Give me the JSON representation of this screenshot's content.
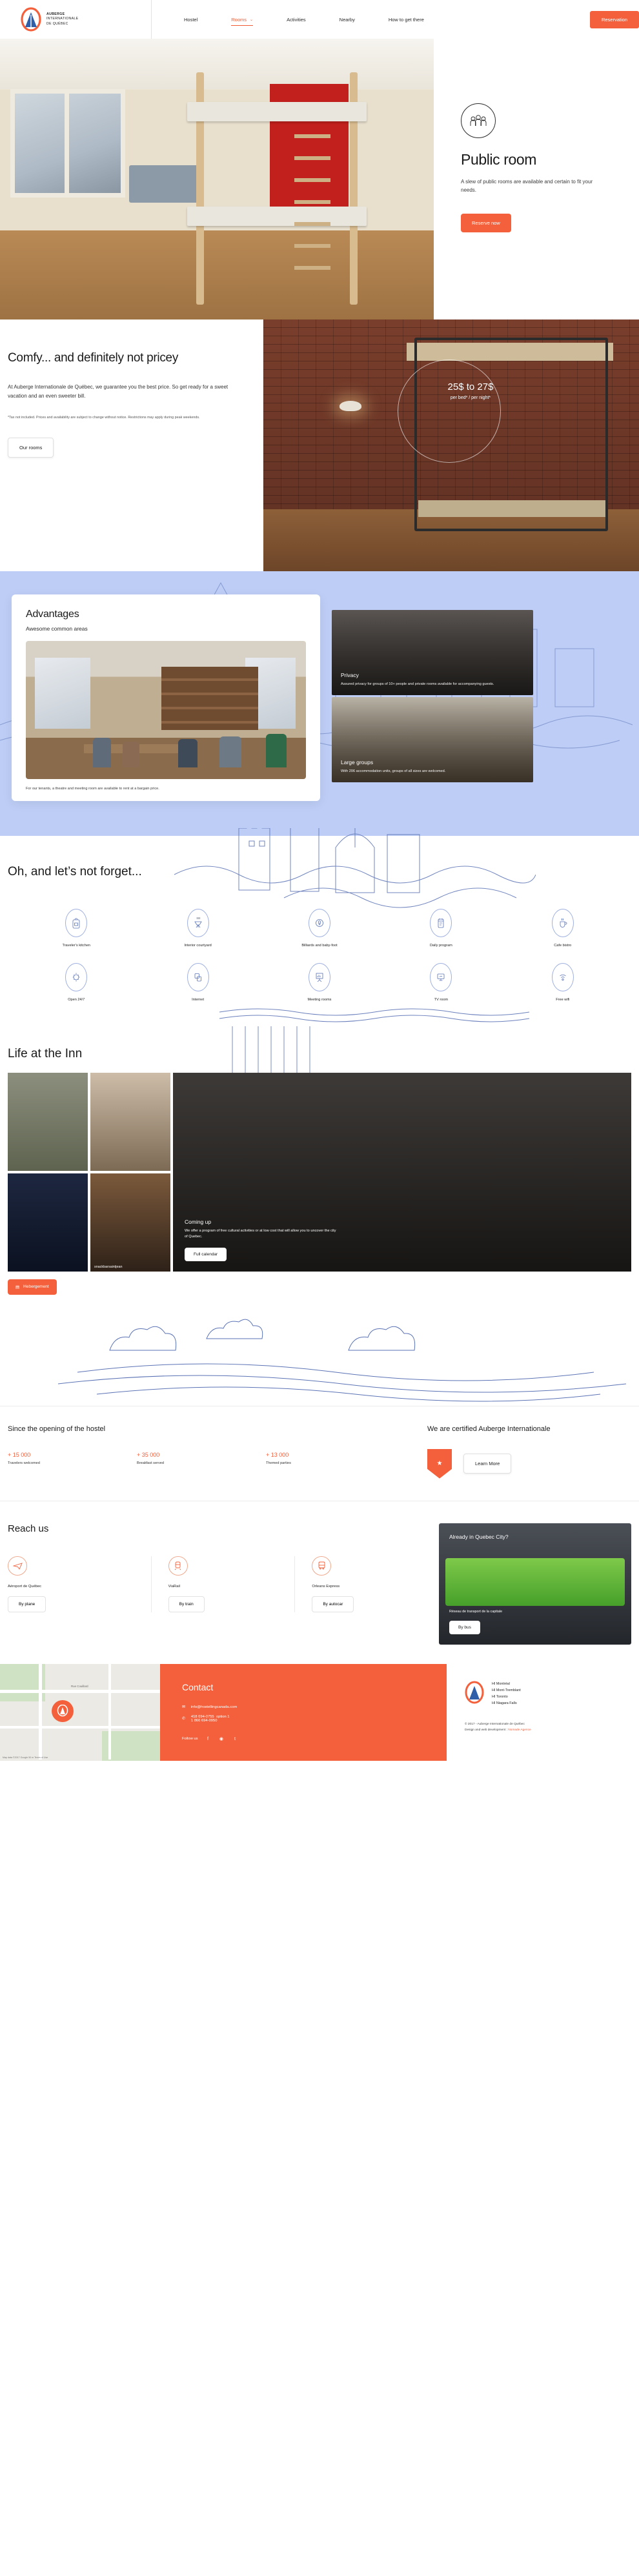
{
  "header": {
    "logo": {
      "line1": "AUBERGE",
      "line2": "INTERNATIONALE",
      "line3": "DE QUÉBEC"
    },
    "nav": [
      {
        "label": "Hostel",
        "active": false
      },
      {
        "label": "Rooms",
        "active": true,
        "chevron": "chevron-down-icon"
      },
      {
        "label": "Activities",
        "active": false
      },
      {
        "label": "Nearby",
        "active": false
      },
      {
        "label": "How to get there",
        "active": false
      }
    ],
    "reservation_button": "Reservation"
  },
  "hero": {
    "icon": "group-people-icon",
    "title": "Public room",
    "description": "A slew of public rooms are available and certain to fit your needs.",
    "cta": "Reserve now"
  },
  "pricing": {
    "title": "Comfy... and definitely not pricey",
    "lead": "At Auberge Internationale de Québec, we guarantee you the best price. So get ready for a sweet vacation and an even sweeter bill.",
    "fine_print": "*Tax not included. Prices and availability are subject to change without notice. Restrictions may apply during peak weekends.",
    "cta": "Our rooms",
    "price_main": "25$ to 27$",
    "price_sub": "per bed* / per night*"
  },
  "advantages": {
    "title": "Advantages",
    "subtitle": "Awesome common areas",
    "footnote": "For our tenants, a theatre and meeting room are available to rent at a bargain price.",
    "tiles": [
      {
        "title": "Privacy",
        "desc": "Assured privacy for groups of 10+ people and private rooms available for accompanying guests."
      },
      {
        "title": "Large groups",
        "desc": "With 206 accommodation units, groups of all sizes are welcomed."
      }
    ]
  },
  "amenities": {
    "title": "Oh, and let’s not forget...",
    "items": [
      {
        "label": "Traveler's kitchen",
        "icon": "backpack-icon"
      },
      {
        "label": "Interior courtyard",
        "icon": "grill-icon"
      },
      {
        "label": "Billiards and baby-foot",
        "icon": "billiard-ball-icon"
      },
      {
        "label": "Daily program",
        "icon": "calendar-phone-icon"
      },
      {
        "label": "Cafe bistro",
        "icon": "coffee-cup-icon"
      },
      {
        "label": "Open 24/7",
        "icon": "sun-icon"
      },
      {
        "label": "Internet",
        "icon": "computer-icon"
      },
      {
        "label": "Meeting rooms",
        "icon": "presentation-board-icon"
      },
      {
        "label": "TV room",
        "icon": "tv-screen-icon"
      },
      {
        "label": "Free wifi",
        "icon": "wifi-icon"
      }
    ]
  },
  "life": {
    "title": "Life at the Inn",
    "photo_caption": "snackbarsaintjean",
    "coming_up": {
      "title": "Coming up",
      "desc": "We offer a program of free cultural activities or at low cost that will allow you to uncover the city of Quebec.",
      "cta": "Full calendar"
    },
    "hebergement_button": "Hebergement"
  },
  "stats": {
    "title": "Since the opening of the hostel",
    "items": [
      {
        "value": "+ 15 000",
        "label": "Travelers welcomed"
      },
      {
        "value": "+ 35 000",
        "label": "Breakfast served"
      },
      {
        "value": "+ 13 000",
        "label": "Themed parties"
      }
    ],
    "certified": {
      "title": "We are certified Auberge Internationale",
      "badge_icon": "award-shield-icon",
      "cta": "Learn More"
    }
  },
  "reach": {
    "title": "Reach us",
    "items": [
      {
        "name": "Aéroport de Québec",
        "button": "By plane",
        "icon": "plane-icon"
      },
      {
        "name": "ViaRail",
        "button": "By train",
        "icon": "train-icon"
      },
      {
        "name": "Orleans Express",
        "button": "By autocar",
        "icon": "bus-icon"
      }
    ],
    "promo": {
      "title": "Already in Quebec City?",
      "caption": "Réseau de transport de la capitale",
      "cta": "By bus"
    }
  },
  "footer": {
    "map": {
      "street_label": "Rue Couillard",
      "pin_icon": "location-pin-icon",
      "attribution": "Map data ©2017 Google   50 m   Terms of Use"
    },
    "contact": {
      "title": "Contact",
      "email": "info@hostellingcanada.com",
      "email_icon": "mail-icon",
      "phone_primary": "418 694-0755",
      "phone_secondary": "1 866 694-0950",
      "phone_suffix": "option 1",
      "phone_icon": "phone-icon",
      "follow_label": "Follow us",
      "social": [
        {
          "name": "facebook-icon",
          "glyph": "f"
        },
        {
          "name": "instagram-icon",
          "glyph": "◉"
        },
        {
          "name": "twitter-icon",
          "glyph": "t"
        }
      ]
    },
    "addresses": {
      "logo_icon": "auberge-logo-icon",
      "list": [
        "HI Montréal",
        "HI Mont-Tremblant",
        "HI Toronto",
        "HI Niagara Falls"
      ],
      "copyright": "© 2017 - Auberge Internationale de Québec",
      "credit_prefix": "Design and web development : ",
      "credit_link": "Nomade Agence"
    }
  },
  "colors": {
    "accent": "#f3603b",
    "blue_panel": "#bdcdf5",
    "line_blue": "#5a72b5"
  }
}
